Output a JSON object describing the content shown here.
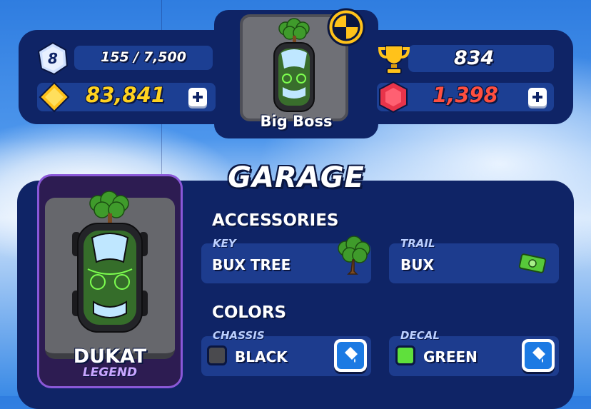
{
  "player": {
    "level": "8",
    "xp": "155 / 7,500",
    "coins": "83,841",
    "trophies": "834",
    "gems": "1,398"
  },
  "featured_car": {
    "name": "Big Boss"
  },
  "garage": {
    "title": "GARAGE",
    "card": {
      "name": "DUKAT",
      "rarity": "LEGEND"
    },
    "accessories": {
      "title": "ACCESSORIES",
      "key": {
        "label": "KEY",
        "value": "BUX TREE",
        "icon": "bux-tree-icon"
      },
      "trail": {
        "label": "TRAIL",
        "value": "BUX",
        "icon": "cash-icon"
      }
    },
    "colors": {
      "title": "COLORS",
      "chassis": {
        "label": "CHASSIS",
        "value": "BLACK",
        "swatch": "#4a4a4e"
      },
      "decal": {
        "label": "DECAL",
        "value": "GREEN",
        "swatch": "#5fe03c"
      }
    }
  },
  "colors": {
    "panel": "#0f2466",
    "accent_yellow": "#ffd21f",
    "accent_red": "#ff4f3f",
    "card_border": "#8a58d8"
  }
}
